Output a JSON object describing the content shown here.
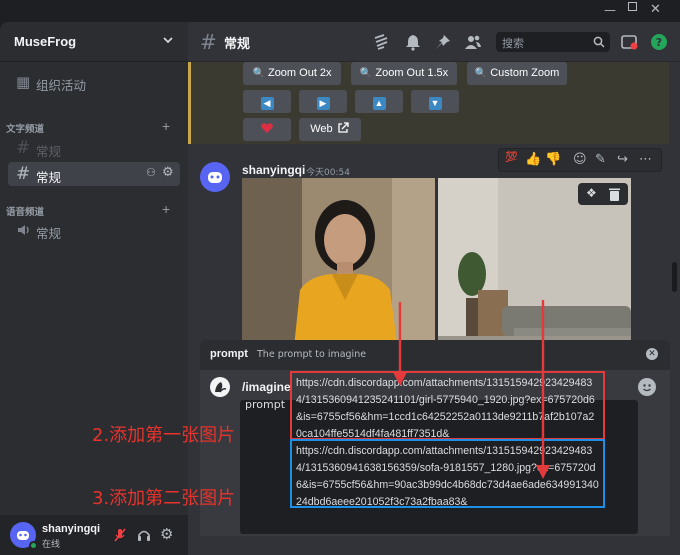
{
  "server": {
    "name": "MuseFrog"
  },
  "sidebar": {
    "events_label": "组织活动",
    "text_category": "文字频道",
    "text_channels": [
      {
        "label": "常规",
        "state": "muted"
      },
      {
        "label": "常规",
        "state": "selected"
      }
    ],
    "voice_category": "语音频道",
    "voice_channels": [
      {
        "label": "常规"
      }
    ]
  },
  "user": {
    "name": "shanyingqi",
    "status": "在线"
  },
  "channel": {
    "title": "常规",
    "search_placeholder": "搜索"
  },
  "embed_buttons": {
    "zoom2x": "Zoom Out 2x",
    "zoom15x": "Zoom Out 1.5x",
    "custom_zoom": "Custom Zoom",
    "web": "Web"
  },
  "message": {
    "author": "shanyingqi",
    "time": "今天00:54"
  },
  "autocomplete": {
    "option": "prompt",
    "description": "The prompt to imagine"
  },
  "composer": {
    "command": "/imagine",
    "option_label": "prompt",
    "url1": "https://cdn.discordapp.com/attachments/1315159429234294834/1315360941235241101/girl-5775940_1920.jpg?ex=675720d6&is=6755cf56&hm=1ccd1c64252252a0113de9211b7af2b107a20ca104ffe5514df4fa481ff7351d&",
    "url2": "https://cdn.discordapp.com/attachments/1315159429234294834/1315360941638156359/sofa-9181557_1280.jpg?ex=675720d6&is=6755cf56&hm=90ac3b99dc4b68dc73d4ae6ade63499134024dbd6aeee201052f3c73a2fbaa83&"
  },
  "annotations": {
    "first": "2.添加第一张图片",
    "second": "3.添加第二张图片"
  },
  "colors": {
    "annotation": "#e8332c",
    "box_first": "#e33b3b",
    "box_second": "#1d8fe6",
    "accent": "#5865f2"
  }
}
